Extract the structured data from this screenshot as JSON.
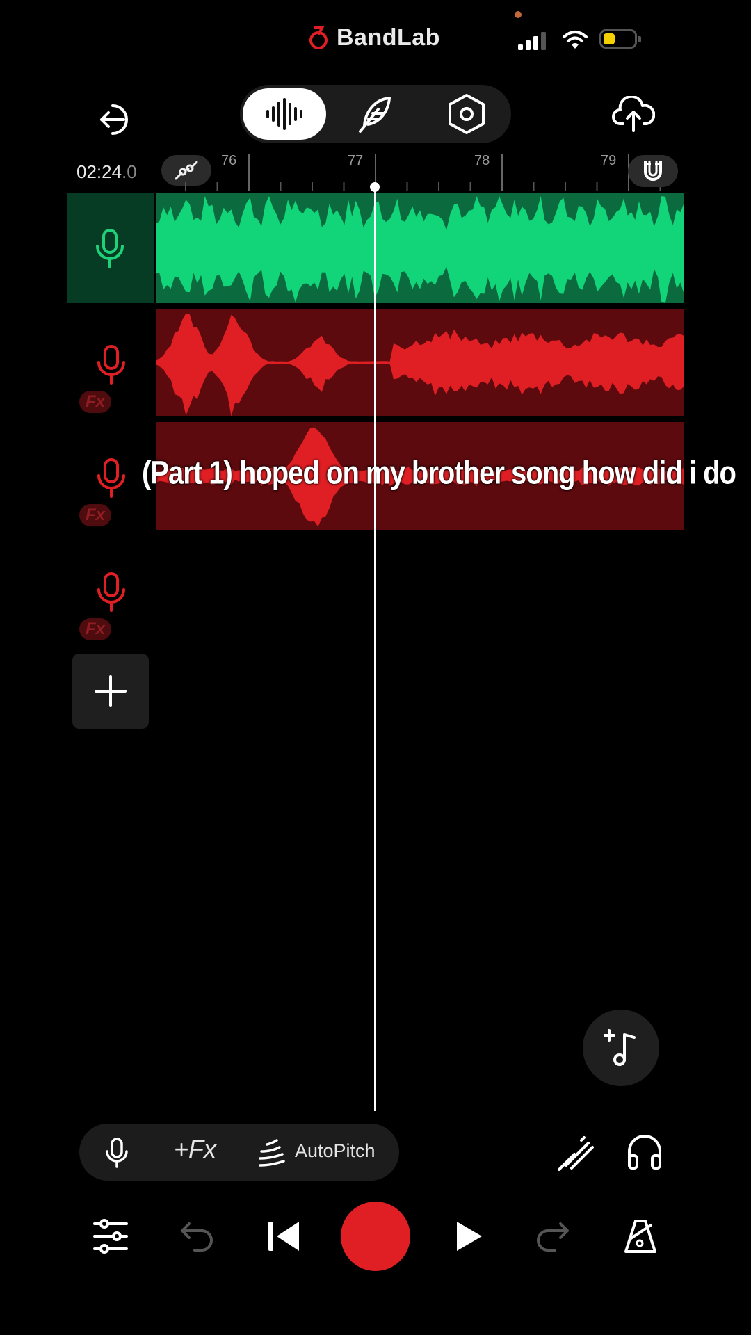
{
  "status_bar": {
    "brand": "BandLab",
    "signal_icon": "cellular-signal-icon",
    "wifi_icon": "wifi-icon",
    "battery_icon": "battery-icon",
    "battery_color": "#f4d000"
  },
  "toolbar": {
    "back_icon": "exit-icon",
    "modes": [
      {
        "icon": "waveform-icon",
        "selected": true
      },
      {
        "icon": "feather-icon",
        "selected": false
      },
      {
        "icon": "settings-hex-icon",
        "selected": false
      }
    ],
    "upload_icon": "cloud-upload-icon"
  },
  "timeline": {
    "time_main": "02:24",
    "time_fraction": ".0",
    "bars": [
      "76",
      "77",
      "78",
      "79"
    ],
    "automation_icon": "automation-icon",
    "snap_icon": "magnet-icon"
  },
  "tracks": [
    {
      "icon": "microphone-icon",
      "color": "#1fd27a",
      "selected": true,
      "fx": false
    },
    {
      "icon": "microphone-icon",
      "color": "#e01f24",
      "selected": false,
      "fx": true,
      "fx_label": "Fx"
    },
    {
      "icon": "microphone-icon",
      "color": "#e01f24",
      "selected": false,
      "fx": true,
      "fx_label": "Fx"
    },
    {
      "icon": "microphone-icon",
      "color": "#e01f24",
      "selected": false,
      "fx": true,
      "fx_label": "Fx"
    }
  ],
  "add_track_icon": "plus-icon",
  "caption": "(Part 1) hoped on my brother song how did i do",
  "add_loop_icon": "add-music-note-icon",
  "record_tools": {
    "mic_icon": "microphone-icon",
    "fx_label": "+Fx",
    "autopitch_icon": "autopitch-icon",
    "autopitch_label": "AutoPitch"
  },
  "tuner_icon": "tuner-icon",
  "headphones_icon": "headphones-icon",
  "transport": {
    "mixer_icon": "mixer-sliders-icon",
    "undo_icon": "undo-icon",
    "rewind_icon": "skip-back-icon",
    "record_icon": "record-icon",
    "play_icon": "play-icon",
    "redo_icon": "redo-icon",
    "metronome_icon": "metronome-icon"
  },
  "colors": {
    "accent_green": "#1fd27a",
    "accent_red": "#e01f24",
    "background": "#000000"
  }
}
